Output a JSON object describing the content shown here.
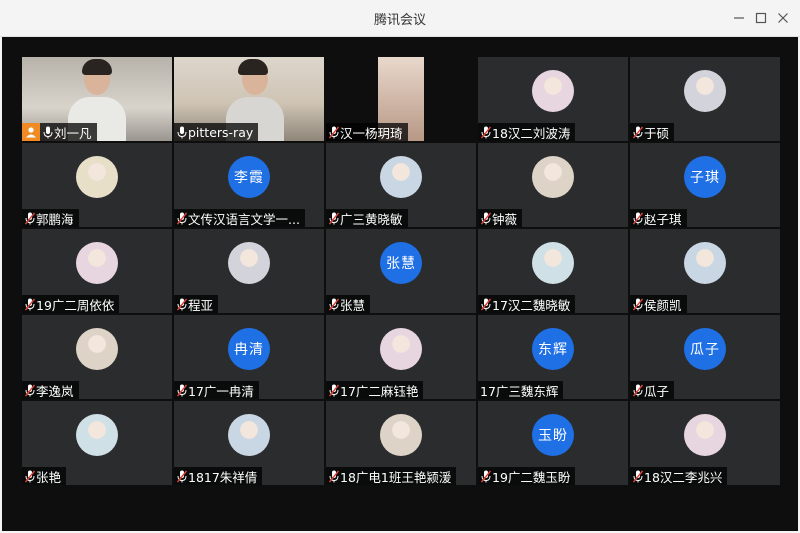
{
  "window": {
    "title": "腾讯会议"
  },
  "colors": {
    "accent_avatar": "#1f6fe5",
    "active_speaker": "#3fae4a",
    "host_badge": "#f08a24",
    "mic_muted": "#e0453a"
  },
  "participants": [
    {
      "name": "刘一凡",
      "kind": "video",
      "mic": "on",
      "host": true
    },
    {
      "name": "pitters-ray",
      "kind": "video",
      "mic": "on",
      "active": true
    },
    {
      "name": "汉一杨玥琦",
      "kind": "video",
      "mic": "muted"
    },
    {
      "name": "18汉二刘波涛",
      "kind": "photo",
      "mic": "muted"
    },
    {
      "name": "于硕",
      "kind": "photo",
      "mic": "muted"
    },
    {
      "name": "郭鹏海",
      "kind": "photo",
      "mic": "muted"
    },
    {
      "name": "文传汉语言文学一...",
      "kind": "text",
      "avatar_text": "李霞",
      "mic": "muted"
    },
    {
      "name": "广三黄晓敏",
      "kind": "photo",
      "mic": "muted"
    },
    {
      "name": "钟薇",
      "kind": "photo",
      "mic": "muted"
    },
    {
      "name": "赵子琪",
      "kind": "text",
      "avatar_text": "子琪",
      "mic": "muted"
    },
    {
      "name": "19广二周依依",
      "kind": "photo",
      "mic": "muted"
    },
    {
      "name": "程亚",
      "kind": "photo",
      "mic": "muted"
    },
    {
      "name": "张慧",
      "kind": "text",
      "avatar_text": "张慧",
      "mic": "muted"
    },
    {
      "name": "17汉二魏晓敏",
      "kind": "photo",
      "mic": "muted"
    },
    {
      "name": "侯颜凯",
      "kind": "photo",
      "mic": "muted"
    },
    {
      "name": "李逸岚",
      "kind": "photo",
      "mic": "muted"
    },
    {
      "name": "17广一冉清",
      "kind": "text",
      "avatar_text": "冉清",
      "mic": "muted"
    },
    {
      "name": "17广二麻钰艳",
      "kind": "photo",
      "mic": "muted"
    },
    {
      "name": "17广三魏东辉",
      "kind": "text",
      "avatar_text": "东辉",
      "mic": "none"
    },
    {
      "name": "瓜子",
      "kind": "text",
      "avatar_text": "瓜子",
      "mic": "muted"
    },
    {
      "name": "张艳",
      "kind": "photo",
      "mic": "muted"
    },
    {
      "name": "1817朱祥倩",
      "kind": "photo",
      "mic": "muted"
    },
    {
      "name": "18广电1班王艳颍湲",
      "kind": "photo",
      "mic": "muted"
    },
    {
      "name": "19广二魏玉盼",
      "kind": "text",
      "avatar_text": "玉盼",
      "mic": "muted"
    },
    {
      "name": "18汉二李兆兴",
      "kind": "photo",
      "mic": "muted"
    }
  ]
}
